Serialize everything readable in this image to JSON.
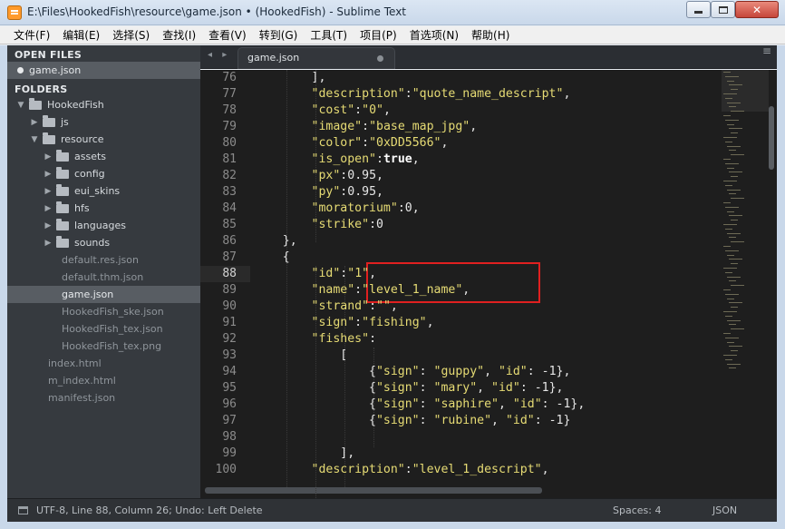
{
  "window": {
    "title": "E:\\Files\\HookedFish\\resource\\game.json • (HookedFish) - Sublime Text",
    "min_label": "",
    "max_label": "",
    "close_label": "✕"
  },
  "menu": [
    "文件(F)",
    "编辑(E)",
    "选择(S)",
    "查找(I)",
    "查看(V)",
    "转到(G)",
    "工具(T)",
    "项目(P)",
    "首选项(N)",
    "帮助(H)"
  ],
  "sidebar": {
    "open_files_header": "OPEN FILES",
    "open_file": "game.json",
    "folders_header": "FOLDERS",
    "tree": [
      {
        "label": "HookedFish",
        "type": "folder",
        "open": true
      },
      {
        "label": "js",
        "type": "folder",
        "open": false
      },
      {
        "label": "resource",
        "type": "folder",
        "open": true
      },
      {
        "label": "assets",
        "type": "folder",
        "open": false
      },
      {
        "label": "config",
        "type": "folder",
        "open": false
      },
      {
        "label": "eui_skins",
        "type": "folder",
        "open": false
      },
      {
        "label": "hfs",
        "type": "folder",
        "open": false
      },
      {
        "label": "languages",
        "type": "folder",
        "open": false
      },
      {
        "label": "sounds",
        "type": "folder",
        "open": false
      },
      {
        "label": "default.res.json",
        "type": "file"
      },
      {
        "label": "default.thm.json",
        "type": "file"
      },
      {
        "label": "game.json",
        "type": "file",
        "selected": true
      },
      {
        "label": "HookedFish_ske.json",
        "type": "file"
      },
      {
        "label": "HookedFish_tex.json",
        "type": "file"
      },
      {
        "label": "HookedFish_tex.png",
        "type": "file"
      },
      {
        "label": "index.html",
        "type": "file"
      },
      {
        "label": "m_index.html",
        "type": "file"
      },
      {
        "label": "manifest.json",
        "type": "file"
      }
    ]
  },
  "tabs": {
    "nav": "◂ ▸",
    "active_tab": "game.json"
  },
  "editor": {
    "current_line": "88",
    "line_numbers": [
      "76",
      "77",
      "78",
      "79",
      "80",
      "81",
      "82",
      "83",
      "84",
      "85",
      "86",
      "87",
      "88",
      "89",
      "90",
      "91",
      "92",
      "93",
      "94",
      "95",
      "96",
      "97",
      "98",
      "99",
      "100"
    ],
    "lines": [
      "        ],",
      "        \"description\":\"quote_name_descript\",",
      "        \"cost\":\"0\",",
      "        \"image\":\"base_map_jpg\",",
      "        \"color\":\"0xDD5566\",",
      "        \"is_open\":true,",
      "        \"px\":0.95,",
      "        \"py\":0.95,",
      "        \"moratorium\":0,",
      "        \"strike\":0",
      "    },",
      "    {",
      "        \"id\":\"1\",",
      "        \"name\":\"level_1_name\",",
      "        \"strand\":\"\",",
      "        \"sign\":\"fishing\",",
      "        \"fishes\":",
      "            [",
      "                {\"sign\": \"guppy\", \"id\": -1},",
      "                {\"sign\": \"mary\", \"id\": -1},",
      "                {\"sign\": \"saphire\", \"id\": -1},",
      "                {\"sign\": \"rubine\", \"id\": -1}",
      "",
      "            ],",
      "        \"description\":\"level_1_descript\","
    ]
  },
  "status": {
    "text": "UTF-8, Line 88, Column 26; Undo: Left Delete",
    "spaces": "Spaces: 4",
    "syntax": "JSON"
  },
  "colors": {
    "editor_bg": "#1e1e1e",
    "sidebar_bg": "#363a3f",
    "string": "#e6db74",
    "highlight_box": "#e02020"
  }
}
